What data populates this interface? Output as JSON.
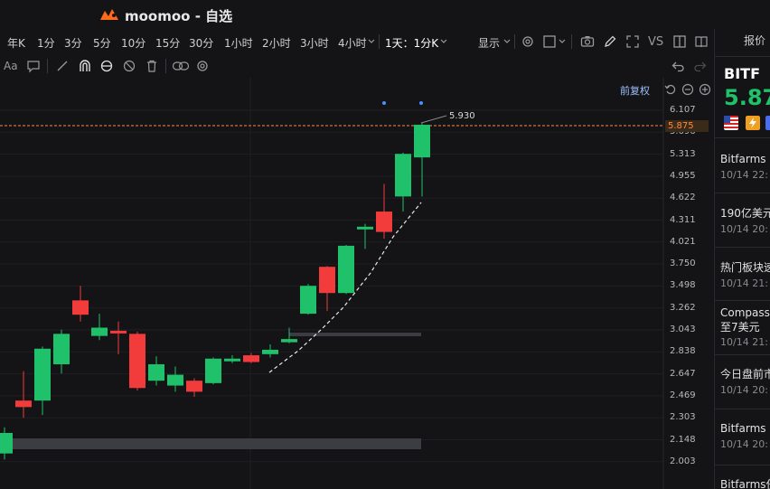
{
  "app": {
    "title": "moomoo - 自选"
  },
  "toolbar": {
    "timeframes": [
      "年K",
      "1分",
      "3分",
      "5分",
      "10分",
      "15分",
      "30分",
      "1小时",
      "2小时",
      "3小时",
      "4小时",
      "1天：1分K"
    ],
    "display_label": "显示",
    "vs_label": "VS"
  },
  "chart": {
    "adjust_label": "前复权",
    "current_price_tag": "5.875",
    "high_annotation": "5.930",
    "price_ticks": [
      "6.107",
      "5.696",
      "5.313",
      "4.955",
      "4.622",
      "4.311",
      "4.021",
      "3.750",
      "3.498",
      "3.262",
      "3.043",
      "2.838",
      "2.647",
      "2.469",
      "2.303",
      "2.148",
      "2.003"
    ]
  },
  "chart_data": {
    "type": "candlestick",
    "price_ticks": [
      6.107,
      5.696,
      5.313,
      4.955,
      4.622,
      4.311,
      4.021,
      3.75,
      3.498,
      3.262,
      3.043,
      2.838,
      2.647,
      2.469,
      2.303,
      2.148,
      2.003
    ],
    "candles": [
      {
        "o": 2.08,
        "c": 2.22,
        "h": 2.26,
        "l": 2.04,
        "dir": "up"
      },
      {
        "o": 2.46,
        "c": 2.41,
        "h": 2.7,
        "l": 2.33,
        "dir": "down"
      },
      {
        "o": 2.46,
        "c": 2.9,
        "h": 2.92,
        "l": 2.35,
        "dir": "up"
      },
      {
        "o": 2.76,
        "c": 3.04,
        "h": 3.08,
        "l": 2.68,
        "dir": "up"
      },
      {
        "o": 3.38,
        "c": 3.23,
        "h": 3.54,
        "l": 3.16,
        "dir": "down"
      },
      {
        "o": 3.02,
        "c": 3.1,
        "h": 3.24,
        "l": 2.98,
        "dir": "up"
      },
      {
        "o": 3.07,
        "c": 3.06,
        "h": 3.16,
        "l": 2.85,
        "dir": "down"
      },
      {
        "o": 3.04,
        "c": 2.56,
        "h": 3.06,
        "l": 2.54,
        "dir": "down"
      },
      {
        "o": 2.62,
        "c": 2.76,
        "h": 2.83,
        "l": 2.58,
        "dir": "up"
      },
      {
        "o": 2.58,
        "c": 2.67,
        "h": 2.74,
        "l": 2.53,
        "dir": "up"
      },
      {
        "o": 2.62,
        "c": 2.53,
        "h": 2.64,
        "l": 2.49,
        "dir": "down"
      },
      {
        "o": 2.6,
        "c": 2.81,
        "h": 2.82,
        "l": 2.59,
        "dir": "up"
      },
      {
        "o": 2.79,
        "c": 2.81,
        "h": 2.84,
        "l": 2.77,
        "dir": "up"
      },
      {
        "o": 2.84,
        "c": 2.78,
        "h": 2.86,
        "l": 2.77,
        "dir": "down"
      },
      {
        "o": 2.85,
        "c": 2.89,
        "h": 2.94,
        "l": 2.82,
        "dir": "up"
      },
      {
        "o": 2.96,
        "c": 2.99,
        "h": 3.1,
        "l": 2.95,
        "dir": "up"
      },
      {
        "o": 3.24,
        "c": 3.54,
        "h": 3.56,
        "l": 3.23,
        "dir": "up"
      },
      {
        "o": 3.76,
        "c": 3.46,
        "h": 3.77,
        "l": 3.27,
        "dir": "down"
      },
      {
        "o": 3.46,
        "c": 4.02,
        "h": 4.03,
        "l": 3.45,
        "dir": "up"
      },
      {
        "o": 4.27,
        "c": 4.24,
        "h": 4.31,
        "l": 3.98,
        "dir": "up"
      },
      {
        "o": 4.48,
        "c": 4.2,
        "h": 4.89,
        "l": 4.11,
        "dir": "down"
      },
      {
        "o": 4.7,
        "c": 5.38,
        "h": 5.4,
        "l": 4.48,
        "dir": "up"
      },
      {
        "o": 5.32,
        "c": 5.9,
        "h": 5.93,
        "l": 4.7,
        "dir": "up"
      }
    ],
    "high_label": 5.93,
    "current_price": 5.875
  },
  "right_panel": {
    "tab_label": "报价",
    "symbol": "BITF",
    "last_price": "5.87",
    "news": [
      {
        "title": "Bitfarms",
        "time": "10/14 22:"
      },
      {
        "title": "190亿美元",
        "time": "10/14 20:"
      },
      {
        "title": "热门板块速",
        "time": "10/14 21:"
      },
      {
        "title": "Compass",
        "title2": "至7美元",
        "time": "10/14 21:"
      },
      {
        "title": "今日盘前市",
        "time": "10/14 20:"
      },
      {
        "title": "Bitfarms",
        "time": "10/14 20:"
      },
      {
        "title": "Bitfarms任",
        "time": ""
      }
    ]
  },
  "colors": {
    "up": "#1fc26b",
    "down": "#f23b3b",
    "accent": "#ff8a3d",
    "background": "#141416"
  }
}
